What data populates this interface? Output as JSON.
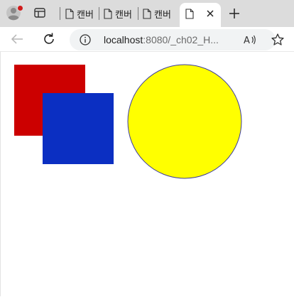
{
  "browser": {
    "tabs": [
      {
        "label": "캔버"
      },
      {
        "label": "캔버"
      },
      {
        "label": "캔버"
      }
    ],
    "active_tab": {
      "label": ""
    },
    "address": {
      "host": "localhost",
      "path": ":8080/_ch02_H..."
    }
  },
  "canvas": {
    "shapes": [
      {
        "type": "rect",
        "name": "red-square",
        "fill": "#cc0000"
      },
      {
        "type": "rect",
        "name": "blue-square",
        "fill": "#0b2fc2"
      },
      {
        "type": "circle",
        "name": "yellow-circle",
        "fill": "#ffff00",
        "stroke": "#3b3ba0"
      }
    ]
  }
}
